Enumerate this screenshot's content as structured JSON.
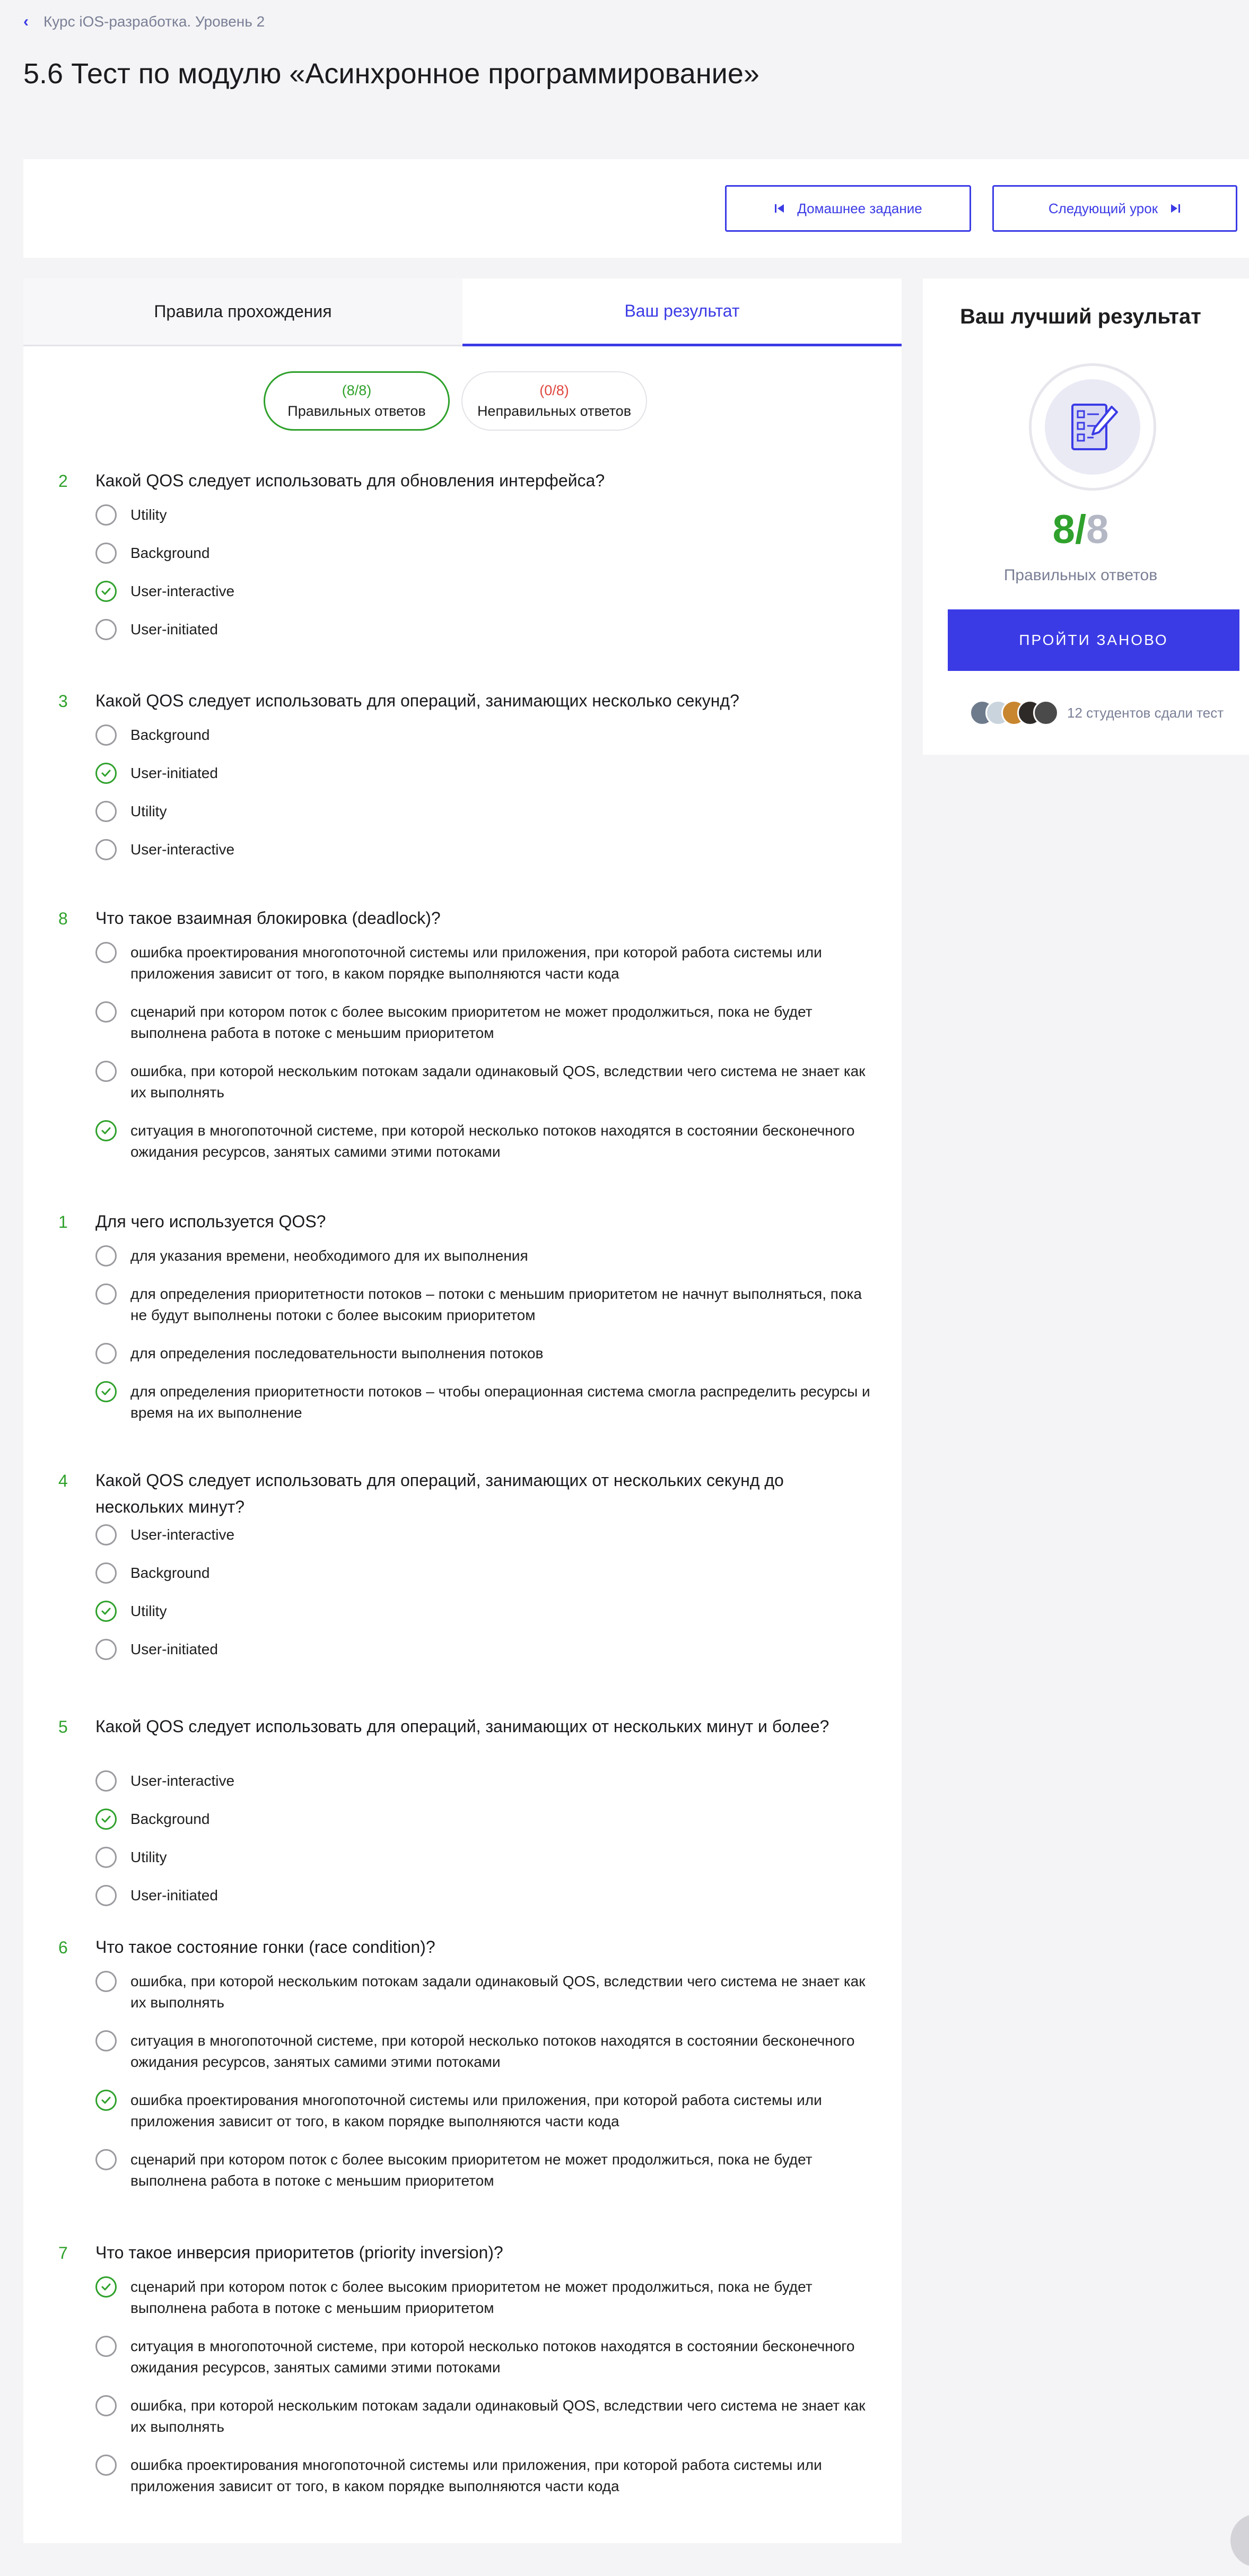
{
  "breadcrumb": {
    "text": "Курс iOS-разработка. Уровень 2"
  },
  "page": {
    "title": "5.6 Тест по модулю «Асинхронное программирование»"
  },
  "toolbar": {
    "homework_label": "Домашнее задание",
    "next_lesson_label": "Следующий урок"
  },
  "tabs": [
    {
      "label": "Правила прохождения",
      "active": false
    },
    {
      "label": "Ваш результат",
      "active": true
    }
  ],
  "summary": {
    "correct_count": "(8/8)",
    "correct_label": "Правильных ответов",
    "wrong_count": "(0/8)",
    "wrong_label": "Неправильных ответов"
  },
  "questions": [
    {
      "num": "2",
      "text": "Какой QOS следует использовать для обновления интерфейса?",
      "options": [
        {
          "text": "Utility",
          "correct": false
        },
        {
          "text": "Background",
          "correct": false
        },
        {
          "text": "User-interactive",
          "correct": true
        },
        {
          "text": "User-initiated",
          "correct": false
        }
      ]
    },
    {
      "num": "3",
      "text": "Какой QOS следует использовать для операций, занимающих несколько секунд?",
      "options": [
        {
          "text": "Background",
          "correct": false
        },
        {
          "text": "User-initiated",
          "correct": true
        },
        {
          "text": "Utility",
          "correct": false
        },
        {
          "text": "User-interactive",
          "correct": false
        }
      ]
    },
    {
      "num": "8",
      "text": "Что такое взаимная блокировка (deadlock)?",
      "options": [
        {
          "text": "ошибка проектирования многопоточной системы или приложения, при которой работа системы или приложения зависит от того, в каком порядке выполняются части кода",
          "correct": false
        },
        {
          "text": "сценарий при котором поток с более высоким приоритетом не может продолжиться, пока не будет выполнена работа в потоке с меньшим приоритетом",
          "correct": false
        },
        {
          "text": "ошибка, при которой нескольким потокам задали одинаковый QOS, вследствии чего система не знает как их выполнять",
          "correct": false
        },
        {
          "text": "ситуация в многопоточной системе, при которой несколько потоков находятся в состоянии бесконечного ожидания ресурсов, занятых самими этими потоками",
          "correct": true
        }
      ]
    },
    {
      "num": "1",
      "text": "Для чего используется QOS?",
      "options": [
        {
          "text": "для указания времени, необходимого для их выполнения",
          "correct": false
        },
        {
          "text": "для определения приоритетности потоков – потоки с меньшим приоритетом не начнут выполняться, пока не будут выполнены потоки с более высоким приоритетом",
          "correct": false
        },
        {
          "text": "для определения последовательности выполнения потоков",
          "correct": false
        },
        {
          "text": "для определения приоритетности потоков – чтобы операционная система смогла распределить ресурсы и время на их выполнение",
          "correct": true
        }
      ]
    },
    {
      "num": "4",
      "text": "Какой QOS следует использовать для операций, занимающих от нескольких секунд до нескольких минут?",
      "options": [
        {
          "text": "User-interactive",
          "correct": false
        },
        {
          "text": "Background",
          "correct": false
        },
        {
          "text": "Utility",
          "correct": true
        },
        {
          "text": "User-initiated",
          "correct": false
        }
      ]
    },
    {
      "num": "5",
      "text": "Какой QOS следует использовать для операций, занимающих от нескольких минут и более?",
      "options": [
        {
          "text": "User-interactive",
          "correct": false
        },
        {
          "text": "Background",
          "correct": true
        },
        {
          "text": "Utility",
          "correct": false
        },
        {
          "text": "User-initiated",
          "correct": false
        }
      ]
    },
    {
      "num": "6",
      "text": "Что такое состояние гонки (race condition)?",
      "options": [
        {
          "text": "ошибка, при которой нескольким потокам задали одинаковый QOS, вследствии чего система не знает как их выполнять",
          "correct": false
        },
        {
          "text": "ситуация в многопоточной системе, при которой несколько потоков находятся в состоянии бесконечного ожидания ресурсов, занятых самими этими потоками",
          "correct": false
        },
        {
          "text": "ошибка проектирования многопоточной системы или приложения, при которой работа системы или приложения зависит от того, в каком порядке выполняются части кода",
          "correct": true
        },
        {
          "text": "сценарий при котором поток с более высоким приоритетом не может продолжиться, пока не будет выполнена работа в потоке с меньшим приоритетом",
          "correct": false
        }
      ]
    },
    {
      "num": "7",
      "text": "Что такое инверсия приоритетов (priority inversion)?",
      "options": [
        {
          "text": "сценарий при котором поток с более высоким приоритетом не может продолжиться, пока не будет выполнена работа в потоке с меньшим приоритетом",
          "correct": true
        },
        {
          "text": "ситуация в многопоточной системе, при которой несколько потоков находятся в состоянии бесконечного ожидания ресурсов, занятых самими этими потоками",
          "correct": false
        },
        {
          "text": "ошибка, при которой нескольким потокам задали одинаковый QOS, вследствии чего система не знает как их выполнять",
          "correct": false
        },
        {
          "text": "ошибка проектирования многопоточной системы или приложения, при которой работа системы или приложения зависит от того, в каком порядке выполняются части кода",
          "correct": false
        }
      ]
    }
  ],
  "best_result": {
    "title": "Ваш лучший результат",
    "score_correct": "8",
    "score_separator": "/",
    "score_total": "8",
    "score_label": "Правильных ответов",
    "retry_label": "ПРОЙТИ ЗАНОВО",
    "students_text": "12 студентов сдали тест",
    "avatar_colors": [
      "#6e7b8c",
      "#c9d4dd",
      "#c8862f",
      "#2d2a28",
      "#4a4a4a"
    ]
  },
  "colors": {
    "accent": "#3b3be6",
    "correct": "#2fa12c",
    "wrong": "#e0463f"
  }
}
